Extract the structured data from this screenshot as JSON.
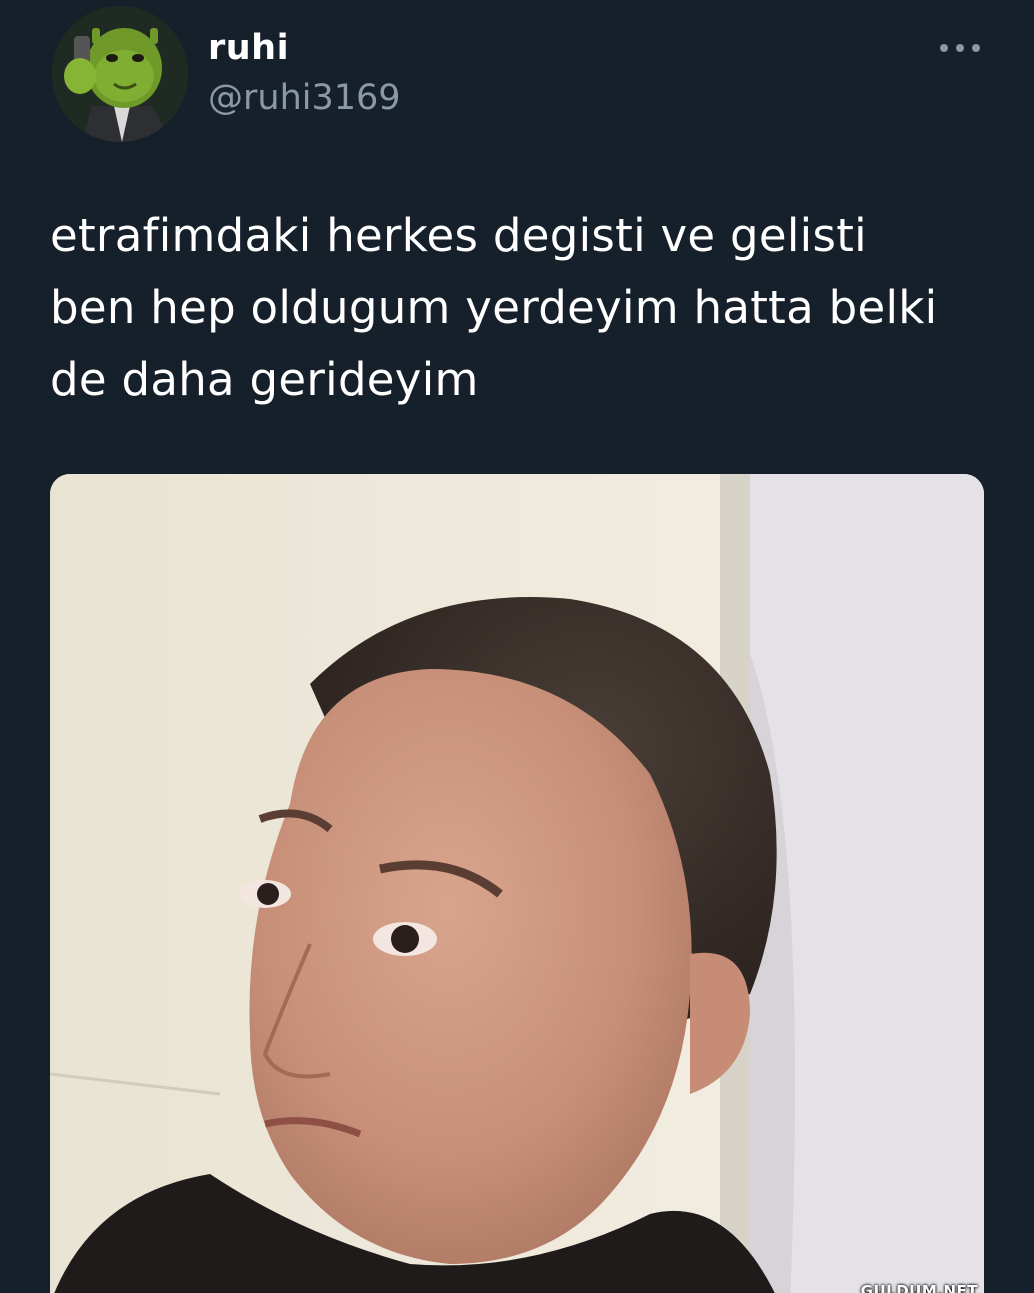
{
  "user": {
    "display_name": "ruhi",
    "handle": "@ruhi3169",
    "avatar_icon": "shrek-avatar-icon"
  },
  "tweet": {
    "text_lines": [
      "etrafimdaki herkes degisti ve gelisti",
      "ben hep oldugum yerdeyim hatta belki",
      "de daha gerideyim"
    ]
  },
  "menu": {
    "icon": "more-options-icon"
  },
  "watermark": {
    "text": "GULDUM.NET"
  },
  "colors": {
    "background": "#15202b",
    "text_primary": "#ffffff",
    "text_secondary": "#8b98a5"
  }
}
